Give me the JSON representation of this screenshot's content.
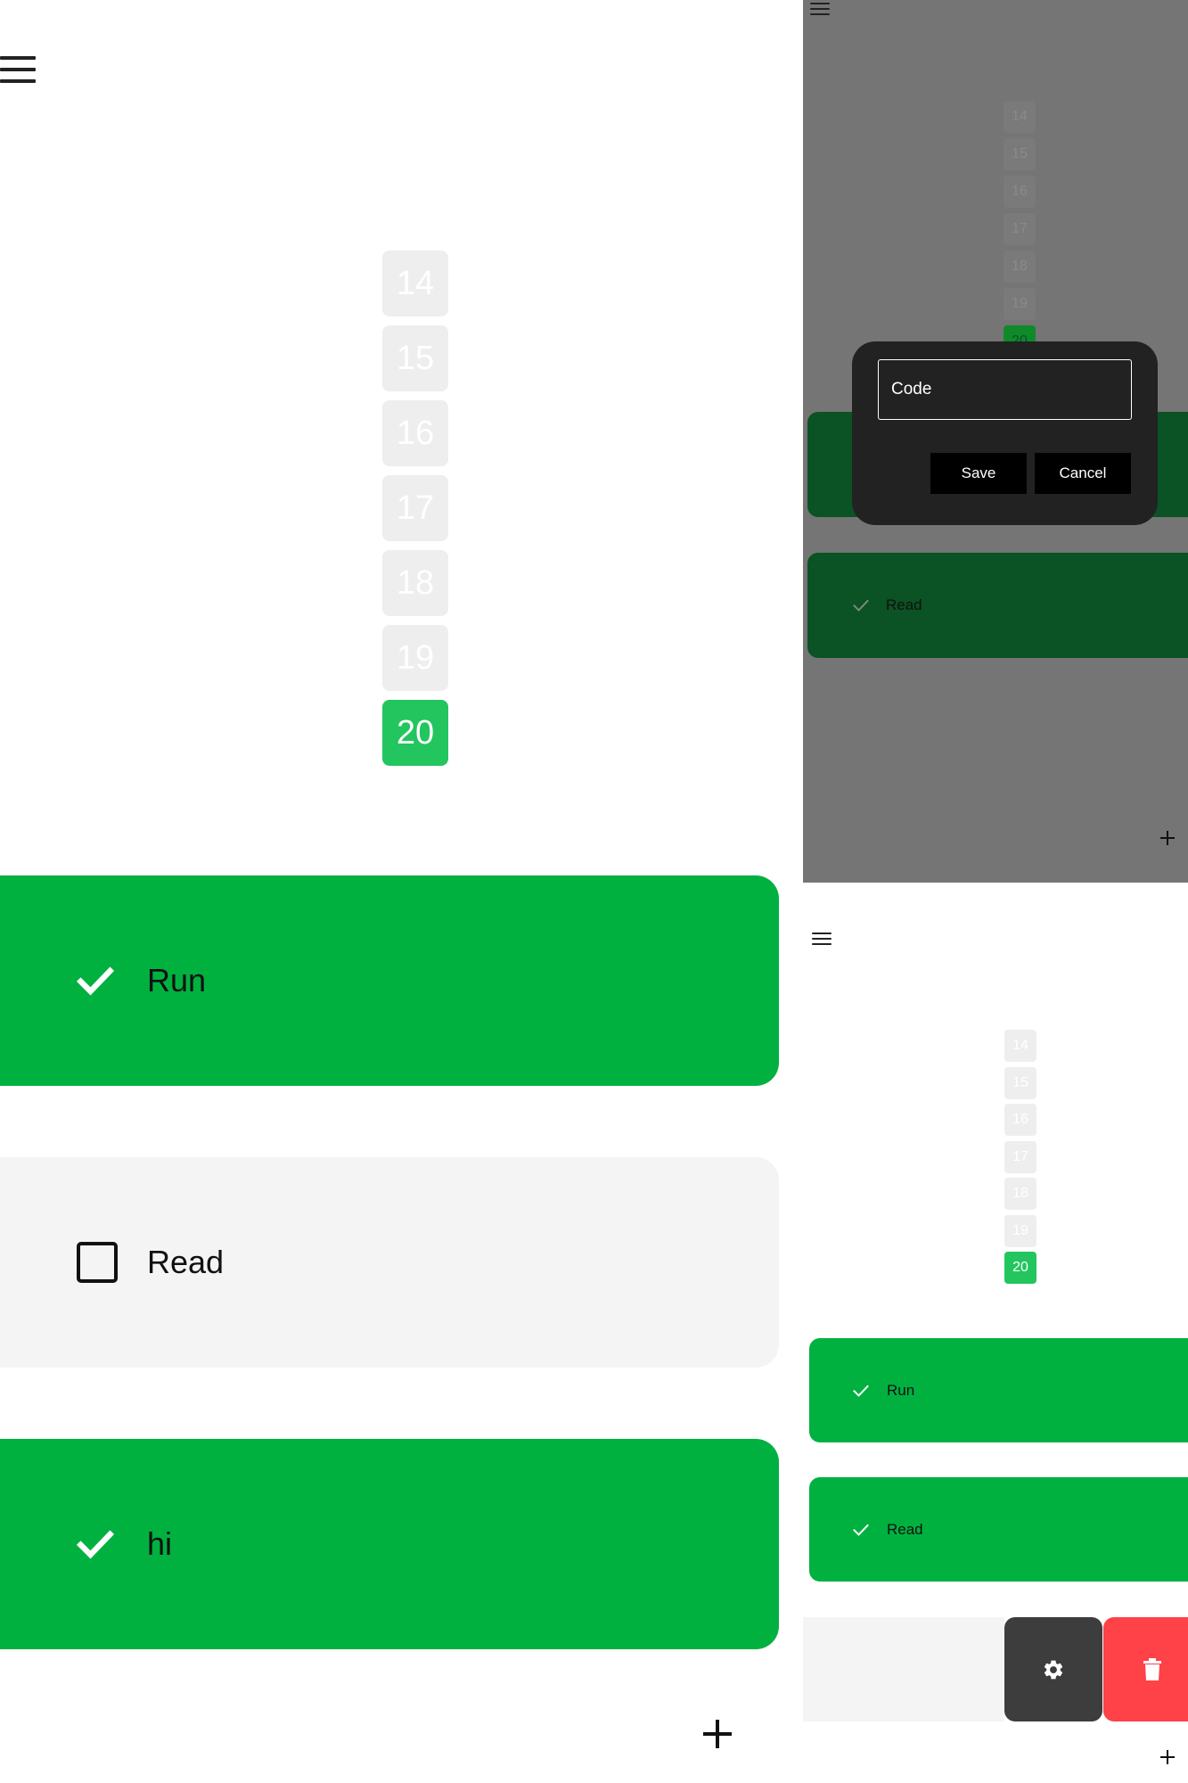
{
  "colors": {
    "accent_green": "#00b140",
    "day_active": "#22c55e",
    "day_inactive": "#eeeeee",
    "unchecked_card": "#f4f4f4",
    "delete_red": "#ff4148",
    "settings_dark": "#3d3d3d",
    "dialog_bg": "#222222"
  },
  "main": {
    "days": [
      "14",
      "15",
      "16",
      "17",
      "18",
      "19",
      "20"
    ],
    "active_day": "20",
    "habits": [
      {
        "label": "Run",
        "done": true
      },
      {
        "label": "Read",
        "done": false
      },
      {
        "label": "hi",
        "done": true
      }
    ]
  },
  "dialog_screen": {
    "days": [
      "14",
      "15",
      "16",
      "17",
      "18",
      "19",
      "20"
    ],
    "active_day": "20",
    "dialog": {
      "input_value": "Code",
      "save_label": "Save",
      "cancel_label": "Cancel"
    },
    "habits": [
      {
        "label": "Read",
        "done": true
      }
    ]
  },
  "swipe_screen": {
    "days": [
      "14",
      "15",
      "16",
      "17",
      "18",
      "19",
      "20"
    ],
    "active_day": "20",
    "habits": [
      {
        "label": "Run",
        "done": true
      },
      {
        "label": "Read",
        "done": true
      }
    ],
    "swipe_actions": [
      "settings",
      "delete"
    ]
  },
  "icons": {
    "menu": "hamburger-menu-icon",
    "check": "checkmark-icon",
    "checkbox": "checkbox-empty-icon",
    "add": "plus-icon",
    "settings": "gear-icon",
    "delete": "trash-icon"
  }
}
